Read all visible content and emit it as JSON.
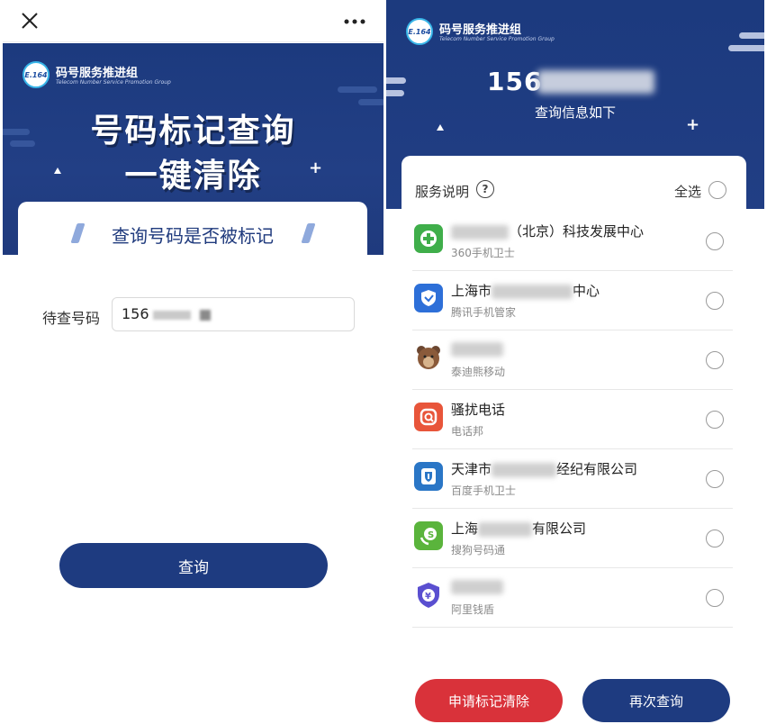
{
  "left": {
    "logo": {
      "badge": "E.164",
      "title": "码号服务推进组",
      "subtitle": "Telecom Number Service Promotion Group"
    },
    "hero": {
      "line1": "号码标记查询",
      "line2": "一键清除"
    },
    "card": {
      "heading": "查询号码是否被标记",
      "field_label": "待查号码",
      "field_value": "156"
    },
    "query_button": "查询"
  },
  "right": {
    "logo": {
      "badge": "E.164",
      "title": "码号服务推进组",
      "subtitle": "Telecom Number Service  Promotion Group"
    },
    "phone_number": "156",
    "subtitle": "查询信息如下",
    "header": {
      "service_note": "服务说明",
      "help_glyph": "?",
      "select_all": "全选"
    },
    "rows": [
      {
        "name_suffix": "（北京）科技发展中心",
        "app": "360手机卫士",
        "icon": "plus-shield-icon",
        "color": "#3fae4a"
      },
      {
        "name_prefix": "上海市",
        "name_suffix": "中心",
        "app": "腾讯手机管家",
        "icon": "tencent-shield-icon",
        "color": "#2d6fd8"
      },
      {
        "app": "泰迪熊移动",
        "icon": "teddy-bear-icon",
        "color": "#8a5a3a"
      },
      {
        "name_prefix": "骚扰电话",
        "app": "电话邦",
        "icon": "phone-bang-icon",
        "color": "#e8553a"
      },
      {
        "name_prefix": "天津市",
        "name_suffix": "经纪有限公司",
        "app": "百度手机卫士",
        "icon": "baidu-shield-icon",
        "color": "#2a76c6"
      },
      {
        "name_prefix": "上海",
        "name_suffix": "有限公司",
        "app": "搜狗号码通",
        "icon": "sogou-phone-icon",
        "color": "#5ab43c"
      },
      {
        "app": "阿里钱盾",
        "icon": "ali-shield-icon",
        "color": "#5a4fd0"
      }
    ],
    "buttons": {
      "clear": "申请标记清除",
      "requery": "再次查询"
    }
  },
  "colors": {
    "navy": "#1e3b80",
    "red": "#d9323a"
  }
}
